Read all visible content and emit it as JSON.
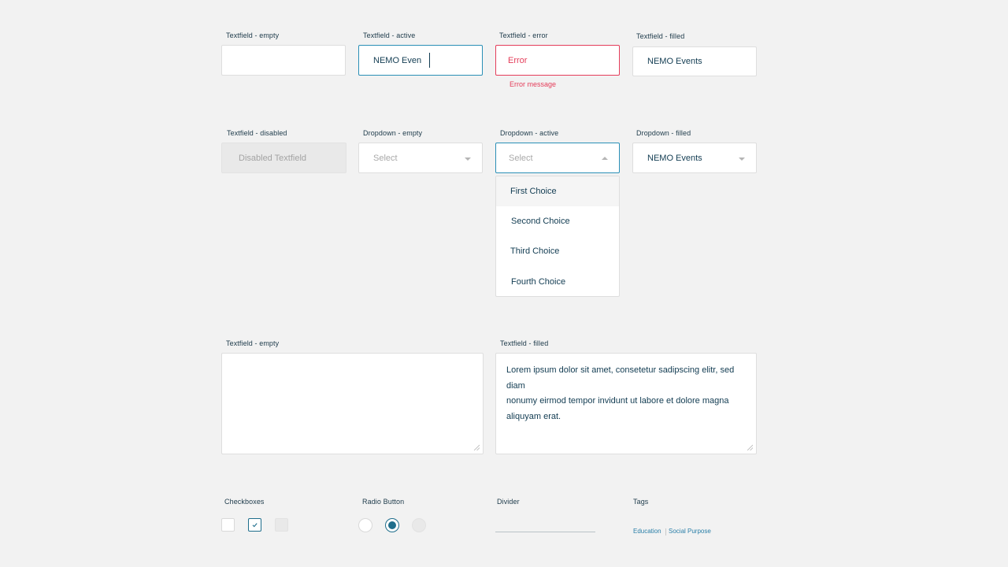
{
  "textfields": {
    "empty_label": "Textfield - empty",
    "active_label": "Textfield - active",
    "active_value": "NEMO Even",
    "error_label": "Textfield - error",
    "error_value": "Error",
    "error_message": "Error message",
    "filled_label": "Textfield - filled",
    "filled_value": "NEMO Events",
    "disabled_label": "Textfield - disabled",
    "disabled_value": "Disabled Textfield"
  },
  "dropdowns": {
    "empty_label": "Dropdown - empty",
    "empty_placeholder": "Select",
    "active_label": "Dropdown - active",
    "active_placeholder": "Select",
    "filled_label": "Dropdown - filled",
    "filled_value": "NEMO Events",
    "options": [
      "First Choice",
      "Second Choice",
      "Third Choice",
      "Fourth Choice"
    ]
  },
  "textareas": {
    "empty_label": "Textfield - empty",
    "filled_label": "Textfield - filled",
    "filled_lines": [
      "Lorem ipsum dolor sit amet, consetetur sadipscing elitr, sed diam",
      "nonumy eirmod tempor invidunt ut labore et dolore magna",
      "aliquyam erat."
    ]
  },
  "controls": {
    "checkboxes_label": "Checkboxes",
    "radio_label": "Radio Button",
    "divider_label": "Divider",
    "tags_label": "Tags",
    "tags": [
      "Education",
      "Social Purpose"
    ]
  },
  "colors": {
    "background": "#f2f2f2",
    "text": "#123c52",
    "accent": "#1f6e8c",
    "active_border": "#2a8fb6",
    "error": "#e43d5a",
    "tag": "#2a7fa8"
  }
}
